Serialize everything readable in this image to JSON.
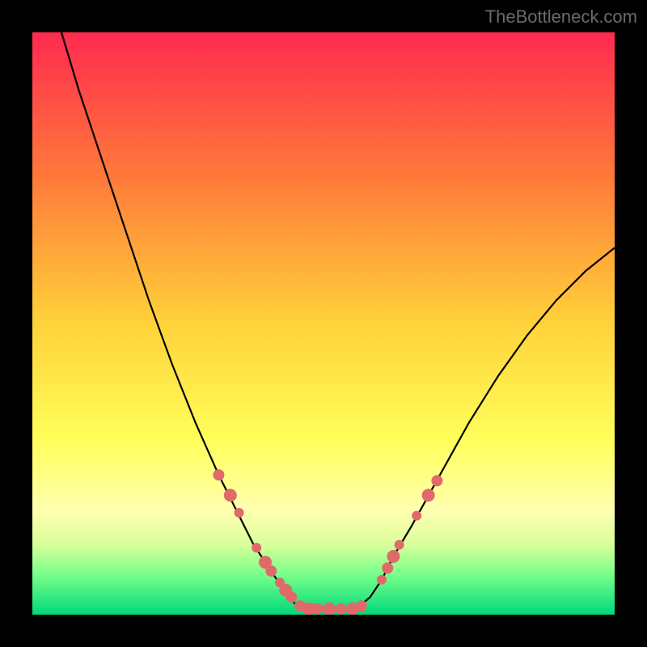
{
  "watermark": "TheBottleneck.com",
  "chart_data": {
    "type": "line",
    "title": "",
    "xlabel": "",
    "ylabel": "",
    "xlim": [
      0,
      100
    ],
    "ylim": [
      0,
      100
    ],
    "background_gradient": {
      "stops": [
        {
          "offset": 0,
          "color": "#ff2a4f"
        },
        {
          "offset": 25,
          "color": "#ff7a3a"
        },
        {
          "offset": 50,
          "color": "#ffd23a"
        },
        {
          "offset": 70,
          "color": "#ffff5a"
        },
        {
          "offset": 82,
          "color": "#ffffb0"
        },
        {
          "offset": 88,
          "color": "#d8ff9a"
        },
        {
          "offset": 93,
          "color": "#7aff8a"
        },
        {
          "offset": 100,
          "color": "#00d97a"
        }
      ]
    },
    "series": [
      {
        "name": "left-branch",
        "x": [
          5,
          8,
          12,
          16,
          20,
          24,
          28,
          32,
          34,
          36,
          38,
          40,
          42,
          43,
          44,
          45,
          46
        ],
        "y": [
          100,
          90,
          78,
          66,
          54,
          43,
          33,
          24,
          20,
          16,
          12,
          9,
          6,
          4.5,
          3,
          2,
          1.3
        ]
      },
      {
        "name": "flat-bottom",
        "x": [
          46,
          48,
          50,
          52,
          54,
          56
        ],
        "y": [
          1.3,
          1.0,
          1.0,
          1.0,
          1.0,
          1.3
        ]
      },
      {
        "name": "right-branch",
        "x": [
          56,
          58,
          60,
          62,
          65,
          70,
          75,
          80,
          85,
          90,
          95,
          100
        ],
        "y": [
          1.3,
          3,
          6,
          10,
          15,
          24,
          33,
          41,
          48,
          54,
          59,
          63
        ]
      }
    ],
    "markers": [
      {
        "x": 32.0,
        "y": 24.0,
        "r": 7
      },
      {
        "x": 34.0,
        "y": 20.5,
        "r": 8
      },
      {
        "x": 35.5,
        "y": 17.5,
        "r": 6
      },
      {
        "x": 38.5,
        "y": 11.5,
        "r": 6
      },
      {
        "x": 40.0,
        "y": 9.0,
        "r": 8
      },
      {
        "x": 41.0,
        "y": 7.5,
        "r": 7
      },
      {
        "x": 42.5,
        "y": 5.5,
        "r": 6
      },
      {
        "x": 43.5,
        "y": 4.2,
        "r": 8
      },
      {
        "x": 44.5,
        "y": 3.0,
        "r": 7
      },
      {
        "x": 46.0,
        "y": 1.5,
        "r": 7
      },
      {
        "x": 47.5,
        "y": 1.0,
        "r": 8
      },
      {
        "x": 49.0,
        "y": 1.0,
        "r": 7
      },
      {
        "x": 51.0,
        "y": 1.0,
        "r": 8
      },
      {
        "x": 53.0,
        "y": 1.0,
        "r": 7
      },
      {
        "x": 55.0,
        "y": 1.0,
        "r": 8
      },
      {
        "x": 56.5,
        "y": 1.5,
        "r": 7
      },
      {
        "x": 60.0,
        "y": 6.0,
        "r": 6
      },
      {
        "x": 61.0,
        "y": 8.0,
        "r": 7
      },
      {
        "x": 62.0,
        "y": 10.0,
        "r": 8
      },
      {
        "x": 63.0,
        "y": 12.0,
        "r": 6
      },
      {
        "x": 66.0,
        "y": 17.0,
        "r": 6
      },
      {
        "x": 68.0,
        "y": 20.5,
        "r": 8
      },
      {
        "x": 69.5,
        "y": 23.0,
        "r": 7
      }
    ],
    "marker_color": "#e06a6a"
  }
}
